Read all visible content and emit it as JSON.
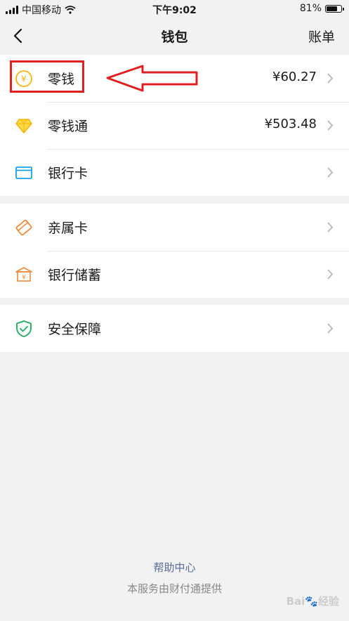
{
  "status_bar": {
    "carrier": "中国移动",
    "time": "下午9:02",
    "battery": "81%",
    "battery_level": 0.81
  },
  "nav": {
    "title": "钱包",
    "right": "账单"
  },
  "groups": [
    {
      "rows": [
        {
          "label": "零钱",
          "amount": "¥60.27",
          "icon": "coin-icon"
        },
        {
          "label": "零钱通",
          "amount": "¥503.48",
          "icon": "diamond-icon"
        },
        {
          "label": "银行卡",
          "amount": "",
          "icon": "card-icon"
        }
      ]
    },
    {
      "rows": [
        {
          "label": "亲属卡",
          "icon": "family-card-icon"
        },
        {
          "label": "银行储蓄",
          "icon": "bank-icon"
        }
      ]
    },
    {
      "rows": [
        {
          "label": "安全保障",
          "icon": "shield-icon"
        }
      ]
    }
  ],
  "footer": {
    "link": "帮助中心",
    "note": "本服务由财付通提供"
  },
  "watermark": "Baidu经验",
  "colors": {
    "accent_yellow": "#f5b400",
    "orange": "#f08a3c",
    "blue": "#1aa0e8",
    "green": "#1aad5a",
    "annotation_red": "#e02020",
    "link": "#576b95"
  }
}
